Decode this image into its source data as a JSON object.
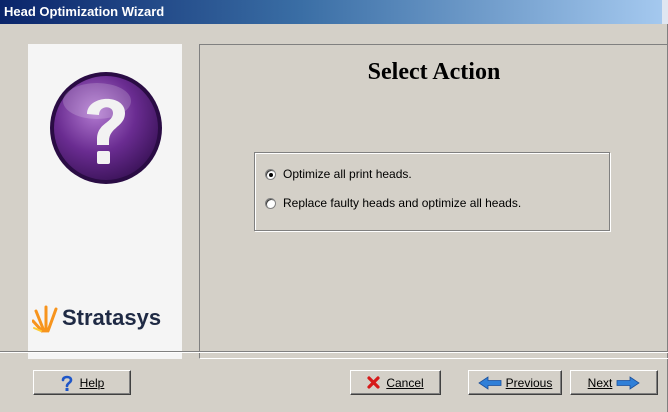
{
  "window": {
    "title": "Head Optimization Wizard"
  },
  "panel": {
    "title": "Select Action"
  },
  "options": [
    {
      "label": "Optimize all print heads.",
      "checked": true
    },
    {
      "label": "Replace faulty heads and optimize all heads.",
      "checked": false
    }
  ],
  "logo": {
    "brand": "Stratasys",
    "icon": "question-mark-icon"
  },
  "buttons": {
    "help": {
      "label": "Help",
      "icon": "question-icon"
    },
    "cancel": {
      "label": "Cancel",
      "icon": "x-icon"
    },
    "previous": {
      "label": "Previous",
      "icon": "arrow-left-icon"
    },
    "next": {
      "label": "Next",
      "icon": "arrow-right-icon"
    }
  },
  "colors": {
    "title_bar": "#0a246a",
    "dialog_bg": "#d4d0c8",
    "brand_orange": "#f7941d",
    "logo_purple": "#6a2c91"
  }
}
